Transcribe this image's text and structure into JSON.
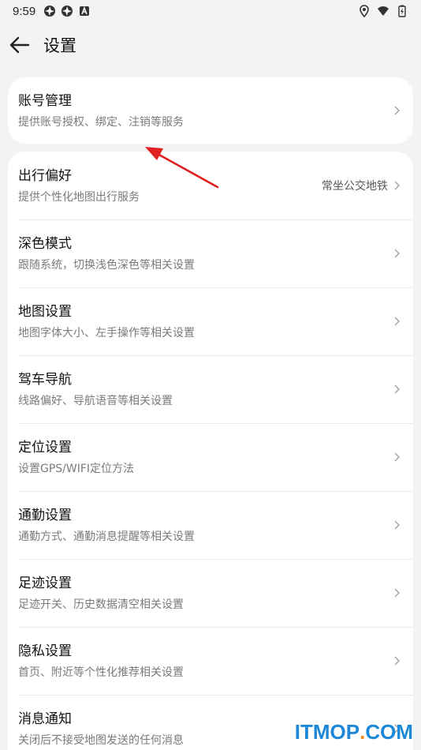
{
  "status_bar": {
    "time": "9:59",
    "left_icons": [
      "aperture-icon",
      "aperture-icon",
      "app-a-icon"
    ],
    "right_icons": [
      "location-icon",
      "wifi-icon",
      "battery-icon"
    ]
  },
  "header": {
    "title": "设置",
    "back_icon": "arrow-left-icon"
  },
  "account": {
    "title": "账号管理",
    "subtitle": "提供账号授权、绑定、注销等服务"
  },
  "settings": [
    {
      "title": "出行偏好",
      "subtitle": "提供个性化地图出行服务",
      "value": "常坐公交地铁"
    },
    {
      "title": "深色模式",
      "subtitle": "跟随系统，切换浅色深色等相关设置"
    },
    {
      "title": "地图设置",
      "subtitle": "地图字体大小、左手操作等相关设置"
    },
    {
      "title": "驾车导航",
      "subtitle": "线路偏好、导航语音等相关设置"
    },
    {
      "title": "定位设置",
      "subtitle": "设置GPS/WIFI定位方法"
    },
    {
      "title": "通勤设置",
      "subtitle": "通勤方式、通勤消息提醒等相关设置"
    },
    {
      "title": "足迹设置",
      "subtitle": "足迹开关、历史数据清空相关设置"
    },
    {
      "title": "隐私设置",
      "subtitle": "首页、附近等个性化推荐相关设置"
    },
    {
      "title": "消息通知",
      "subtitle": "关闭后不接受地图发送的任何消息"
    }
  ],
  "annotation": {
    "arrow_color": "#e02020"
  },
  "watermark": {
    "part_a": "ITMOP",
    "dot": ".",
    "part_b": "COM"
  },
  "colors": {
    "background": "#f1f3f5",
    "card": "#ffffff",
    "subtitle": "#7a7a7a"
  }
}
